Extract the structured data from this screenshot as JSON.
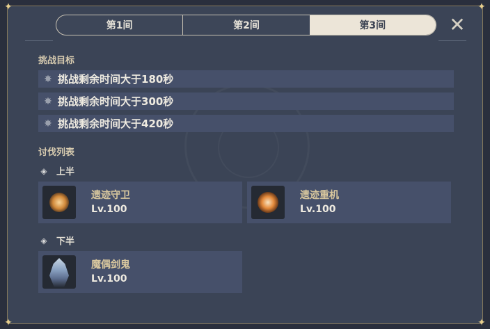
{
  "tabs": [
    {
      "label": "第1间",
      "active": false
    },
    {
      "label": "第2间",
      "active": false
    },
    {
      "label": "第3间",
      "active": true
    }
  ],
  "close_icon": "close-x-icon",
  "challenge": {
    "title": "挑战目标",
    "goals": [
      "挑战剩余时间大于180秒",
      "挑战剩余时间大于300秒",
      "挑战剩余时间大于420秒"
    ],
    "goal_icon": "star-icon"
  },
  "enemies": {
    "title": "讨伐列表",
    "first_half": {
      "label": "上半",
      "list": [
        {
          "name": "遗迹守卫",
          "level": "Lv.100",
          "icon": "ruin-guard-portrait"
        },
        {
          "name": "遗迹重机",
          "level": "Lv.100",
          "icon": "ruin-grader-portrait"
        }
      ]
    },
    "second_half": {
      "label": "下半",
      "list": [
        {
          "name": "魔偶剑鬼",
          "level": "Lv.100",
          "icon": "maguu-kenki-portrait"
        }
      ]
    }
  },
  "colors": {
    "panel_bg": "#3b4456",
    "row_bg": "#46506a",
    "tab_active_bg": "#ece5d8",
    "enemy_name": "#d8c79e",
    "section_title": "#d8ccb0"
  }
}
